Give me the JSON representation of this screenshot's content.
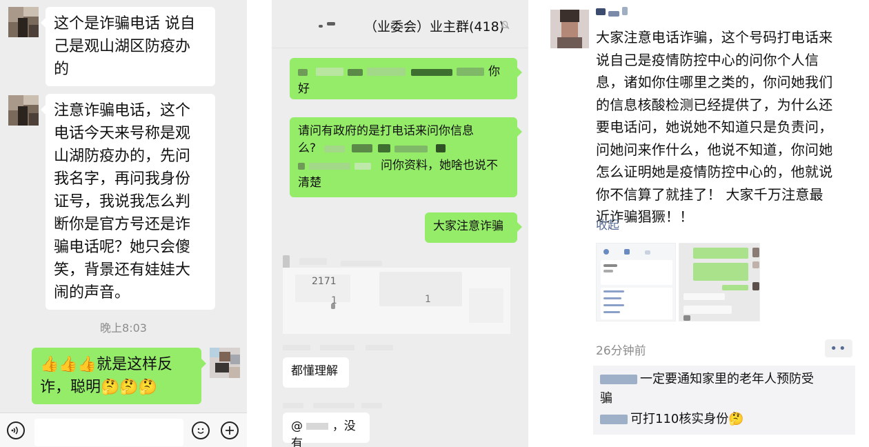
{
  "panel1": {
    "messages": [
      {
        "lines": [
          "这个是诈骗电话 说自",
          "己是观山湖区防疫办",
          "的"
        ]
      },
      {
        "lines": [
          "注意诈骗电话，这个",
          "电话今天来号称是观",
          "山湖防疫办的，先问",
          "我名字，再问我身份",
          "证号，我说我怎么判",
          "断你是官方号还是诈",
          "骗电话呢？她只会傻",
          "笑，背景还有娃娃大",
          "闹的声音。"
        ]
      }
    ],
    "timestamp": "晚上8:03",
    "reply": {
      "line1": "👍👍👍就是这样反",
      "line2": "诈，聪明🤔🤔🤔"
    },
    "inputbar": {
      "voice_icon": "voice-icon",
      "emoji_icon": "emoji-icon",
      "plus_icon": "plus-icon"
    }
  },
  "panel2": {
    "title": "（业委会）业主群(418)",
    "bell_icon": "mute-bell-icon",
    "bubbles": [
      {
        "text_end": "你",
        "line2": "好"
      },
      {
        "line1": "请问有政府的是打电话来问你信息",
        "line2_start": "么?",
        "line3_end": "问你资料，她啥也说不",
        "line4": "清楚"
      },
      {
        "text": "大家注意诈骗"
      }
    ],
    "blurred_fragments": {
      "number": "2171",
      "a": "1",
      "b": "1"
    },
    "replies": [
      {
        "text": "都懂理解"
      },
      {
        "prefix": "@",
        "text": "，没有"
      }
    ]
  },
  "panel3": {
    "post_lines": [
      "大家注意电话诈骗，这个号码打电话来",
      "说自己是疫情防控中心的问你个人信",
      "息，诸如你住哪里之类的，你问她我们",
      "的信息核酸检测已经提供了，为什么还",
      "要电话问，她说她不知道只是负责问，",
      "问她问来作什么，他说不知道，你问她",
      "怎么证明她是疫情防控中心的，他就说",
      "你不信算了就挂了！   大家千万注意最",
      "近诈骗猖獗！！"
    ],
    "collapse_label": "收起",
    "time_ago": "26分钟前",
    "more_label": "••",
    "comments": [
      {
        "line1": "一定要通知家里的老年人预防受",
        "line2": "骗"
      },
      {
        "text": "可打110核实身份🤔"
      }
    ]
  }
}
